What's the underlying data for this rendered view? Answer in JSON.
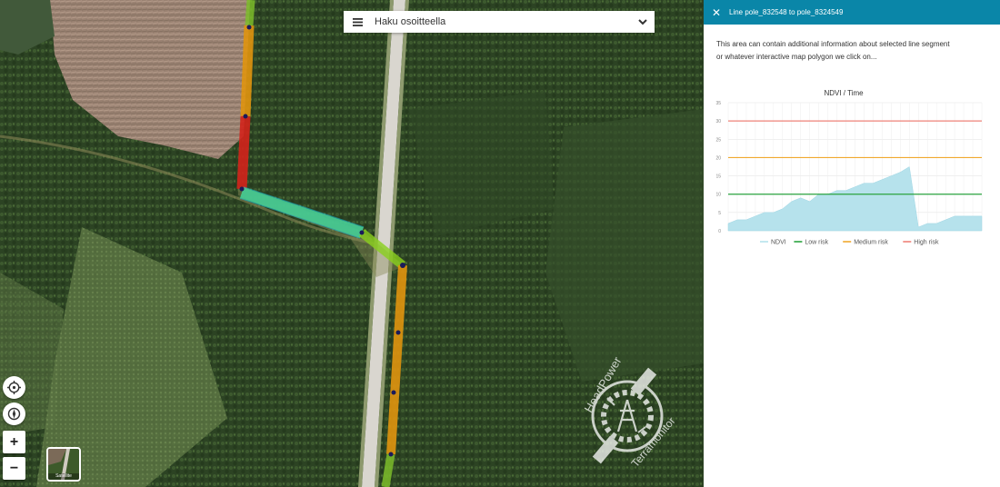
{
  "search": {
    "label": "Haku osoitteella"
  },
  "controls": {
    "zoom_in": "+",
    "zoom_out": "−"
  },
  "layer_switcher": {
    "label": "Satellite"
  },
  "logo": {
    "text_top": "HeadPower",
    "text_bottom": "Terramonitor"
  },
  "panel": {
    "close": "✕",
    "title": "Line pole_832548 to pole_8324549",
    "info_line1": "This area can contain additional information about selected line segment",
    "info_line2": "or whatever interactive map polygon we click on..."
  },
  "colors": {
    "header": "#0a86a8",
    "ndvi": "#b6e2ec",
    "low": "#2aa33f",
    "medium": "#f0a92e",
    "high": "#ee8278"
  },
  "chart_data": {
    "type": "area",
    "title": "NDVI / Time",
    "xlabel": "",
    "ylabel": "",
    "yticks": [
      0,
      5,
      10,
      15,
      20,
      25,
      30,
      35
    ],
    "ylim": [
      0,
      35
    ],
    "grid": true,
    "legend_position": "bottom",
    "x": [
      0,
      1,
      2,
      3,
      4,
      5,
      6,
      7,
      8,
      9,
      10,
      11,
      12,
      13,
      14,
      15,
      16,
      17,
      18,
      19,
      20,
      21,
      22,
      23,
      24,
      25,
      26,
      27,
      28
    ],
    "series": [
      {
        "name": "NDVI",
        "kind": "area",
        "values": [
          2,
          3,
          3,
          4,
          5,
          5,
          6,
          8,
          9,
          8,
          10,
          10,
          11,
          11,
          12,
          13,
          13,
          14,
          15,
          16,
          17.5,
          1,
          2,
          2,
          3,
          4,
          4,
          4,
          4
        ]
      },
      {
        "name": "Low risk",
        "kind": "line",
        "values": [
          10
        ]
      },
      {
        "name": "Medium risk",
        "kind": "line",
        "values": [
          20
        ]
      },
      {
        "name": "High risk",
        "kind": "line",
        "values": [
          30
        ]
      }
    ]
  }
}
